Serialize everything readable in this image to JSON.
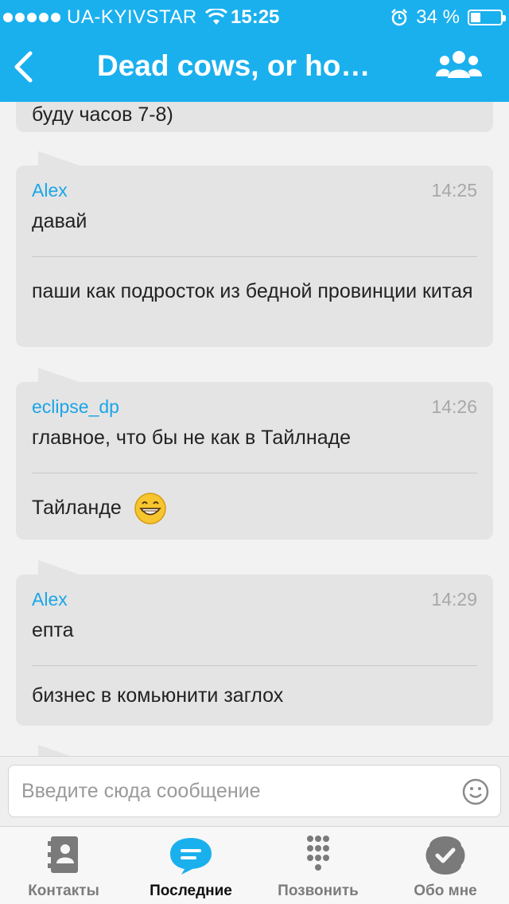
{
  "status_bar": {
    "carrier": "UA-KYIVSTAR",
    "time": "15:25",
    "battery_text": "34 %",
    "battery_level": 0.34
  },
  "header": {
    "title": "Dead cows, or ho…",
    "back_icon": "chevron-left-icon",
    "group_icon": "group-people-icon"
  },
  "chat": {
    "previous_fragment": "буду часов 7-8)",
    "messages": [
      {
        "sender": "Alex",
        "time": "14:25",
        "lines": [
          "давай",
          "паши как подросток из бедной провинции китая"
        ]
      },
      {
        "sender": "eclipse_dp",
        "time": "14:26",
        "lines": [
          "главное, что бы не как в Тайлнаде",
          "Тайланде"
        ]
      },
      {
        "sender": "Alex",
        "time": "14:29",
        "lines": [
          "епта",
          "бизнес в комьюнити заглох"
        ]
      }
    ]
  },
  "composer": {
    "placeholder": "Введите сюда сообщение",
    "emoji_icon": "smiley-icon"
  },
  "tabs": [
    {
      "label": "Контакты",
      "icon": "contacts-icon",
      "active": false
    },
    {
      "label": "Последние",
      "icon": "chat-bubble-icon",
      "active": true
    },
    {
      "label": "Позвонить",
      "icon": "dialpad-icon",
      "active": false
    },
    {
      "label": "Обо мне",
      "icon": "profile-check-icon",
      "active": false
    }
  ],
  "colors": {
    "accent": "#1ab0ee",
    "sender": "#1aa6e6",
    "bubble": "#e4e4e4"
  }
}
